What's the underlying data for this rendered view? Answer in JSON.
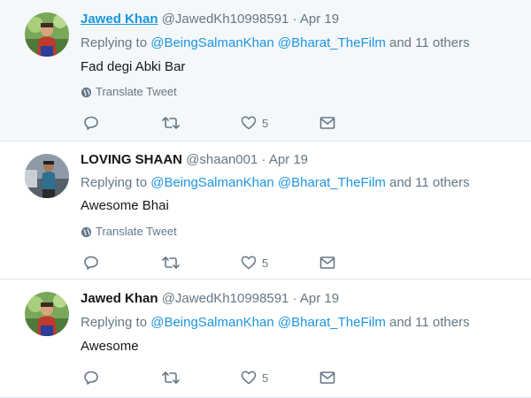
{
  "tweets": [
    {
      "name": "Jawed Khan",
      "handle": "@JawedKh10998591",
      "dot": "·",
      "date": "Apr 19",
      "reply_prefix": "Replying to",
      "mention1": "@BeingSalmanKhan",
      "mention2": "@Bharat_TheFilm",
      "reply_suffix": "and 11 others",
      "text": "Fad degi Abki Bar",
      "translate": "Translate Tweet",
      "likes": "5"
    },
    {
      "name": "LOVING SHAAN",
      "handle": "@shaan001",
      "dot": "·",
      "date": "Apr 19",
      "reply_prefix": "Replying to",
      "mention1": "@BeingSalmanKhan",
      "mention2": "@Bharat_TheFilm",
      "reply_suffix": "and 11 others",
      "text": "Awesome Bhai",
      "translate": "Translate Tweet",
      "likes": "5"
    },
    {
      "name": "Jawed Khan",
      "handle": "@JawedKh10998591",
      "dot": "·",
      "date": "Apr 19",
      "reply_prefix": "Replying to",
      "mention1": "@BeingSalmanKhan",
      "mention2": "@Bharat_TheFilm",
      "reply_suffix": "and 11 others",
      "text": "Awesome",
      "likes": "5"
    }
  ],
  "icons": {
    "reply": "reply-icon",
    "retweet": "retweet-icon",
    "like": "heart-icon",
    "dm": "envelope-icon",
    "globe": "globe-icon"
  },
  "colors": {
    "link": "#1b95e0",
    "secondary": "#657786",
    "highlight_bg": "#f5f8fa",
    "divider": "#e1e8ed"
  }
}
